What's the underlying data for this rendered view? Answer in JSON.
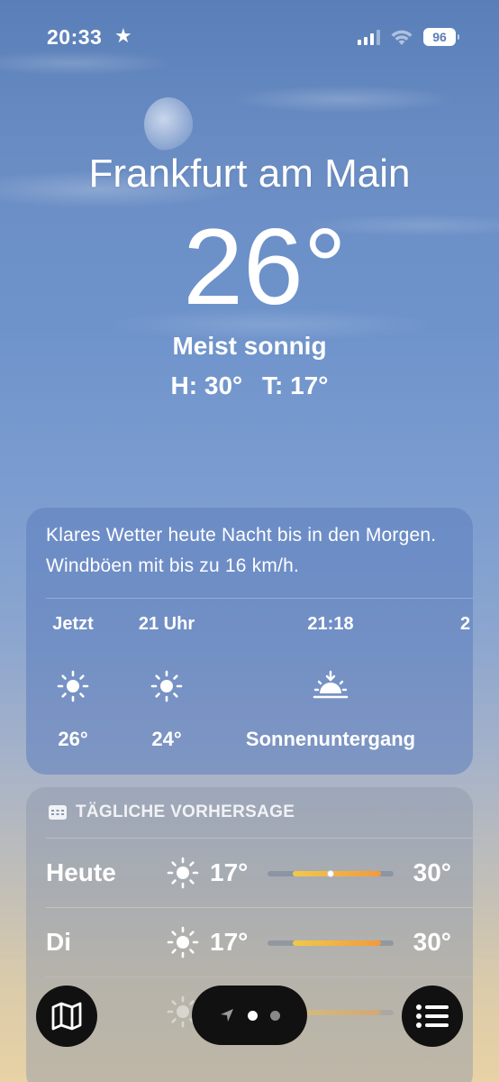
{
  "status_bar": {
    "time": "20:33",
    "star_icon": "star-icon",
    "battery": "96"
  },
  "location": {
    "city": "Frankfurt am Main",
    "temperature": "26°",
    "condition": "Meist sonnig",
    "high": "H: 30°",
    "low": "T: 17°"
  },
  "hourly": {
    "summary": "Klares Wetter heute Nacht bis in den Morgen. Windböen mit bis zu 16 km/h.",
    "items": [
      {
        "label": "Jetzt",
        "icon": "sun-icon",
        "value": "26°"
      },
      {
        "label": "21 Uhr",
        "icon": "sun-icon",
        "value": "24°"
      },
      {
        "label": "21:18",
        "icon": "sunset-icon",
        "value": "Sonnenuntergang"
      },
      {
        "label": "2",
        "icon": "",
        "value": ""
      }
    ]
  },
  "daily": {
    "header": "TÄGLICHE VORHERSAGE",
    "header_icon": "calendar-icon",
    "rows": [
      {
        "day": "Heute",
        "icon": "sun-icon",
        "low": "17°",
        "high": "30°",
        "range_start": 0.2,
        "range_end": 0.9,
        "current": 0.5
      },
      {
        "day": "Di",
        "icon": "sun-icon",
        "low": "17°",
        "high": "30°",
        "range_start": 0.2,
        "range_end": 0.9
      }
    ]
  },
  "colors": {
    "range_start": "#f0c94a",
    "range_end": "#f29a3c",
    "button_bg": "#111111"
  },
  "bottom_bar": {
    "map_icon": "map-icon",
    "location_icon": "location-arrow-icon",
    "list_icon": "list-icon"
  }
}
